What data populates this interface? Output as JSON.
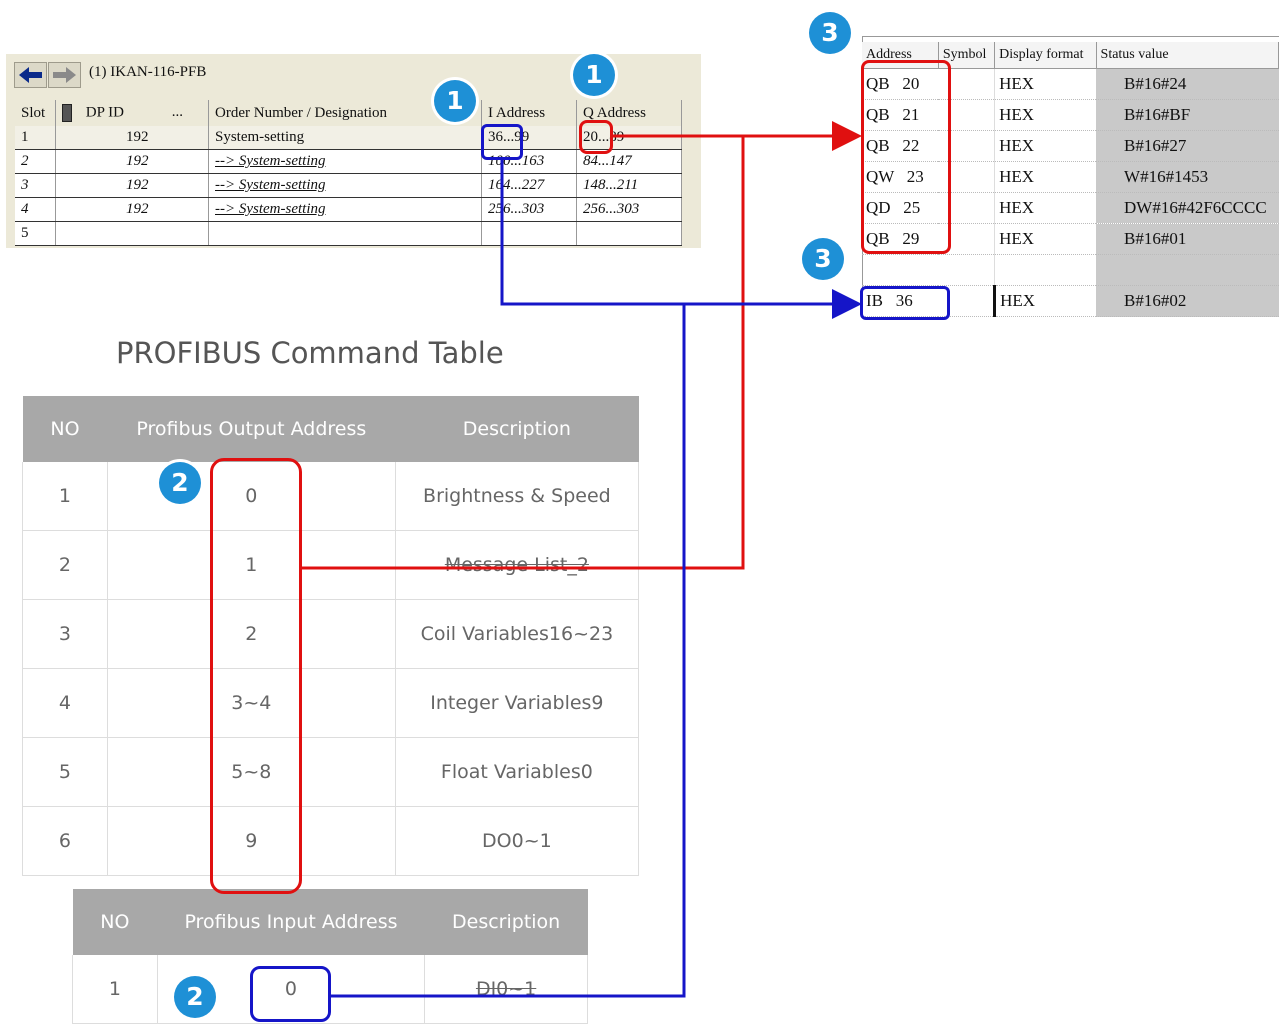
{
  "hw": {
    "title": "(1)  IKAN-116-PFB",
    "headers": {
      "slot": "Slot",
      "dpid": "DP ID",
      "dots": "...",
      "order": "Order Number / Designation",
      "iaddr": "I Address",
      "qaddr": "Q Address"
    },
    "rows": [
      {
        "slot": "1",
        "dpid": "192",
        "order": "System-setting",
        "iaddr": "36...99",
        "qaddr": "20...89"
      },
      {
        "slot": "2",
        "dpid": "192",
        "order": "--> System-setting",
        "iaddr": "100...163",
        "qaddr": "84...147"
      },
      {
        "slot": "3",
        "dpid": "192",
        "order": "--> System-setting",
        "iaddr": "164...227",
        "qaddr": "148...211"
      },
      {
        "slot": "4",
        "dpid": "192",
        "order": "--> System-setting",
        "iaddr": "256...303",
        "qaddr": "256...303"
      },
      {
        "slot": "5",
        "dpid": "",
        "order": "",
        "iaddr": "",
        "qaddr": ""
      }
    ]
  },
  "vartable": {
    "headers": {
      "address": "Address",
      "symbol": "Symbol",
      "format": "Display format",
      "status": "Status value"
    },
    "rows": [
      {
        "addr": "QB   20",
        "format": "HEX",
        "status": "B#16#24"
      },
      {
        "addr": "QB   21",
        "format": "HEX",
        "status": "B#16#BF"
      },
      {
        "addr": "QB   22",
        "format": "HEX",
        "status": "B#16#27"
      },
      {
        "addr": "QW   23",
        "format": "HEX",
        "status": "W#16#1453"
      },
      {
        "addr": "QD   25",
        "format": "HEX",
        "status": "DW#16#42F6CCCC"
      },
      {
        "addr": "QB   29",
        "format": "HEX",
        "status": "B#16#01"
      },
      {
        "addr": "",
        "format": "",
        "status": ""
      },
      {
        "addr": "IB   36",
        "format": "HEX",
        "status": "B#16#02"
      }
    ]
  },
  "command": {
    "title": "PROFIBUS Command Table",
    "output_headers": {
      "no": "NO",
      "addr": "Profibus Output Address",
      "desc": "Description"
    },
    "output_rows": [
      {
        "no": "1",
        "addr": "0",
        "desc": "Brightness & Speed"
      },
      {
        "no": "2",
        "addr": "1",
        "desc": "Message List_2"
      },
      {
        "no": "3",
        "addr": "2",
        "desc": "Coil Variables16~23"
      },
      {
        "no": "4",
        "addr": "3~4",
        "desc": "Integer Variables9"
      },
      {
        "no": "5",
        "addr": "5~8",
        "desc": "Float Variables0"
      },
      {
        "no": "6",
        "addr": "9",
        "desc": "DO0~1"
      }
    ],
    "input_headers": {
      "no": "NO",
      "addr": "Profibus Input Address",
      "desc": "Description"
    },
    "input_rows": [
      {
        "no": "1",
        "addr": "0",
        "desc": "DI0~1"
      }
    ]
  },
  "badges": {
    "one": "1",
    "two": "2",
    "three": "3"
  },
  "colors": {
    "red": "#e01010",
    "blue": "#1515c8",
    "badge": "#1e90d6",
    "header_gray": "#a8a8a8"
  },
  "icons": [
    "back-arrow-icon",
    "forward-arrow-icon",
    "module-icon"
  ]
}
